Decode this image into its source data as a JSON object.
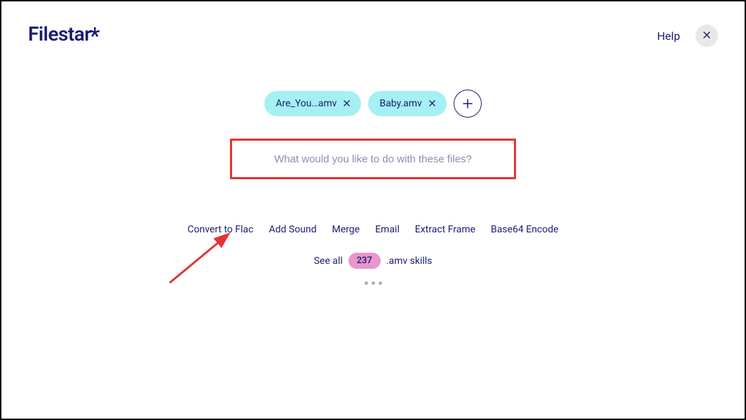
{
  "header": {
    "logo_text": "Filestar",
    "logo_star": "*",
    "help_label": "Help"
  },
  "files": [
    {
      "name": "Are_You…amv"
    },
    {
      "name": "Baby.amv"
    }
  ],
  "search": {
    "placeholder": "What would you like to do with these files?"
  },
  "suggestions": [
    "Convert to Flac",
    "Add Sound",
    "Merge",
    "Email",
    "Extract Frame",
    "Base64 Encode"
  ],
  "see_all": {
    "prefix": "See all",
    "count": "237",
    "suffix": ".amv skills"
  }
}
